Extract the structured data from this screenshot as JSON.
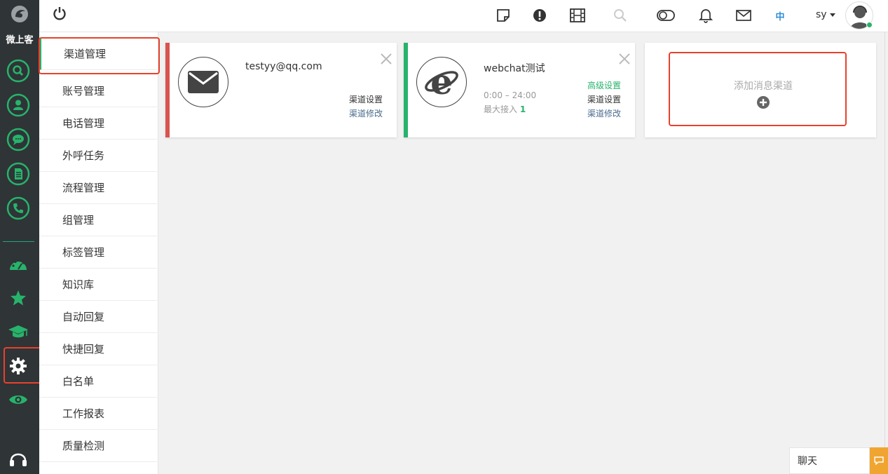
{
  "brand": {
    "name": "微上客"
  },
  "rail_icons": [
    "logo-icon",
    "search-icon",
    "contact-icon",
    "chat-bubble-icon",
    "document-icon",
    "phone-icon",
    "dashboard-icon",
    "star-icon",
    "graduation-cap-icon",
    "gear-icon",
    "eye-icon",
    "headset-icon"
  ],
  "topbar": {
    "language": "中",
    "user": "sy"
  },
  "menu": {
    "items": [
      "渠道管理",
      "账号管理",
      "电话管理",
      "外呼任务",
      "流程管理",
      "组管理",
      "标签管理",
      "知识库",
      "自动回复",
      "快捷回复",
      "白名单",
      "工作报表",
      "质量检测"
    ]
  },
  "channels": [
    {
      "title": "testyy@qq.com",
      "accent": "#d9534f",
      "icon": "envelope-icon",
      "setting": "渠道设置",
      "modify": "渠道修改"
    },
    {
      "title": "webchat测试",
      "accent": "#27b36b",
      "icon": "ie-browser-icon",
      "hours": "0:00 – 24:00",
      "max_label": "最大接入",
      "max_value": "1",
      "advanced": "高级设置",
      "setting": "渠道设置",
      "modify": "渠道修改"
    }
  ],
  "add_channel": {
    "label": "添加消息渠道"
  },
  "chat": {
    "label": "聊天"
  },
  "colors": {
    "rail_bg": "#2f3437",
    "accent_green": "#27b36b",
    "highlight": "#e8412c",
    "chat_orange": "#f0a531"
  }
}
